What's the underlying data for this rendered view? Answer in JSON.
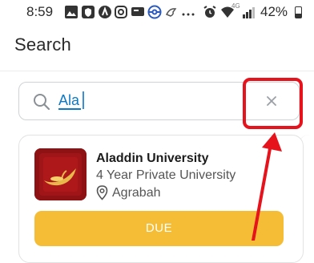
{
  "status_bar": {
    "time": "8:59",
    "battery_percent": "42%",
    "network": "4G",
    "icons": [
      "photo-icon",
      "shield-icon",
      "app-a-icon",
      "instagram-icon",
      "chat-icon",
      "pokeball-icon",
      "bird-icon",
      "more-icon",
      "alarm-icon",
      "wifi-icon",
      "signal-icon",
      "battery-icon"
    ]
  },
  "header": {
    "title": "Search"
  },
  "search": {
    "value": "Ala"
  },
  "results": [
    {
      "name": "Aladdin University",
      "type": "4 Year Private University",
      "location": "Agrabah",
      "status_label": "DUE"
    }
  ],
  "colors": {
    "accent": "#0e7ac4",
    "due_button": "#f5bd35",
    "highlight": "#e6121c",
    "logo_background": "#8e1214"
  }
}
